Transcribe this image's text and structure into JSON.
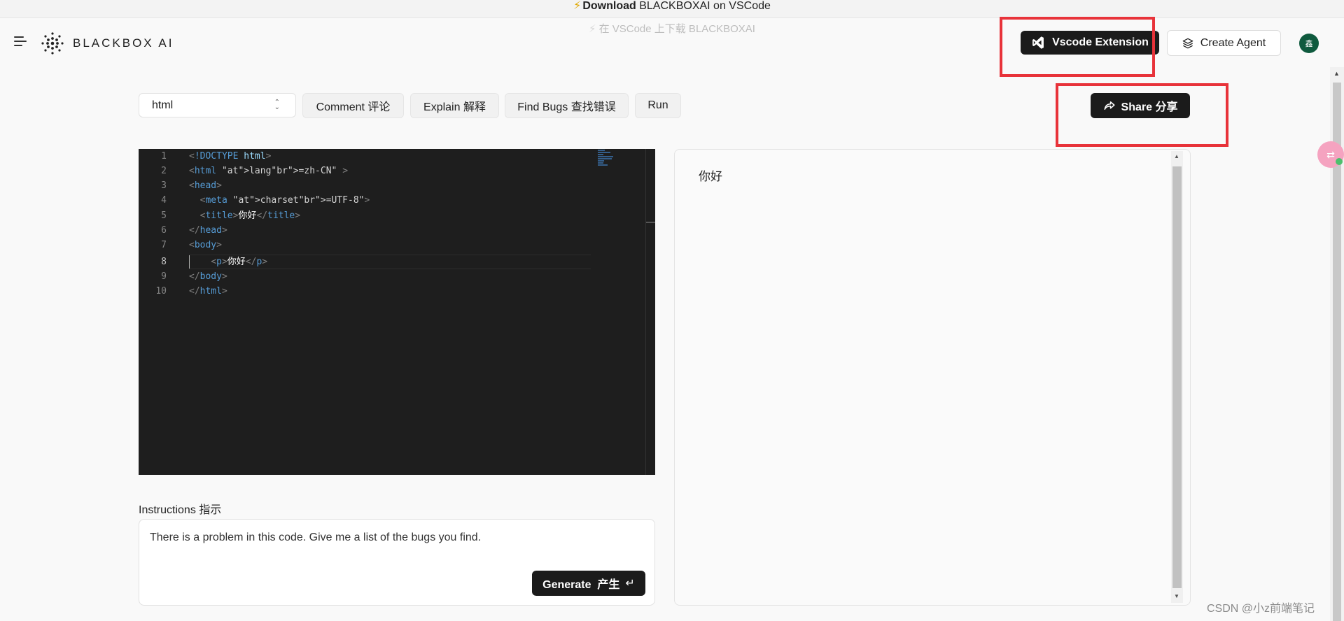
{
  "banner": {
    "bold": "Download",
    "rest": "BLACKBOXAI on VSCode",
    "subtitle": "在 VSCode 上下载 BLACKBOXAI"
  },
  "header": {
    "brand": "BLACKBOX AI",
    "vscode_button": "Vscode Extension",
    "agent_button": "Create Agent",
    "avatar_initial": "鑫"
  },
  "toolbar": {
    "language": "html",
    "comment": "Comment 评论",
    "explain": "Explain 解释",
    "find_bugs": "Find Bugs 查找错误",
    "run": "Run",
    "share": "Share 分享"
  },
  "editor": {
    "line_numbers": [
      "1",
      "2",
      "3",
      "4",
      "5",
      "6",
      "7",
      "8",
      "9",
      "10"
    ],
    "active_line": "8",
    "lines": [
      "<!DOCTYPE html>",
      "<html lang=\"zh-CN\" >",
      "<head>",
      "  <meta charset=\"UTF-8\">",
      "  <title>你好</title>",
      "</head>",
      "<body>",
      "    <p>你好</p>",
      "</body>",
      "</html>"
    ]
  },
  "preview": {
    "text": "你好"
  },
  "instructions": {
    "label": "Instructions 指示",
    "value": "There is a problem in this code. Give me a list of the bugs you find.",
    "generate_button": "Generate  产生",
    "return_glyph": "↵"
  },
  "watermark": "CSDN @小z前端笔记",
  "colors": {
    "accent_dark": "#1b1b1b",
    "highlight_red": "#e8333a",
    "editor_bg": "#1e1e1e",
    "avatar_bg": "#0f5a3e"
  }
}
